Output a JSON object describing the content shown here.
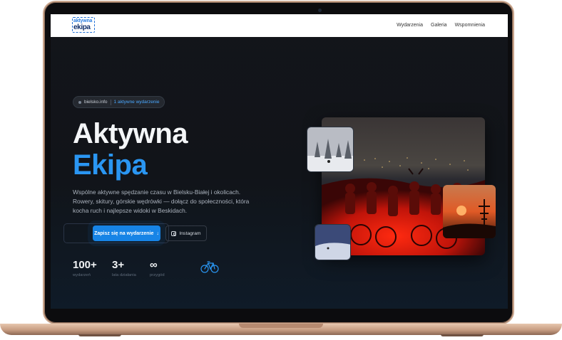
{
  "logo": {
    "line1": "aktywna",
    "line2": "ekipa"
  },
  "nav": {
    "items": [
      {
        "label": "Wydarzenia"
      },
      {
        "label": "Galeria"
      },
      {
        "label": "Wspomnienia"
      }
    ]
  },
  "hero": {
    "pill": {
      "source": "bielsko.info",
      "events": "1 aktywne wydarzenie"
    },
    "title_line1": "Aktywna",
    "title_line2": "Ekipa",
    "description": "Wspólne aktywne spędzanie czasu w Bielsku-Białej i okolicach. Rowery, skitury, górskie wędrówki — dołącz do społeczności, która kocha ruch i najlepsze widoki w Beskidach.",
    "cta_label": "Zapisz się na wydarzenie",
    "cta_arrow": "↓",
    "instagram_label": "Instagram"
  },
  "stats": [
    {
      "value": "100+",
      "label": "wydarzeń"
    },
    {
      "value": "3+",
      "label": "lata działania"
    },
    {
      "value": "∞",
      "label": "przygód"
    }
  ],
  "icons": {
    "bike": "bicycle-icon",
    "instagram": "instagram-icon",
    "pill_dot": "dot-icon"
  },
  "colors": {
    "accent": "#2a96f2",
    "button": "#1784e6",
    "background": "#111419",
    "laptop": "#c9a58c"
  }
}
